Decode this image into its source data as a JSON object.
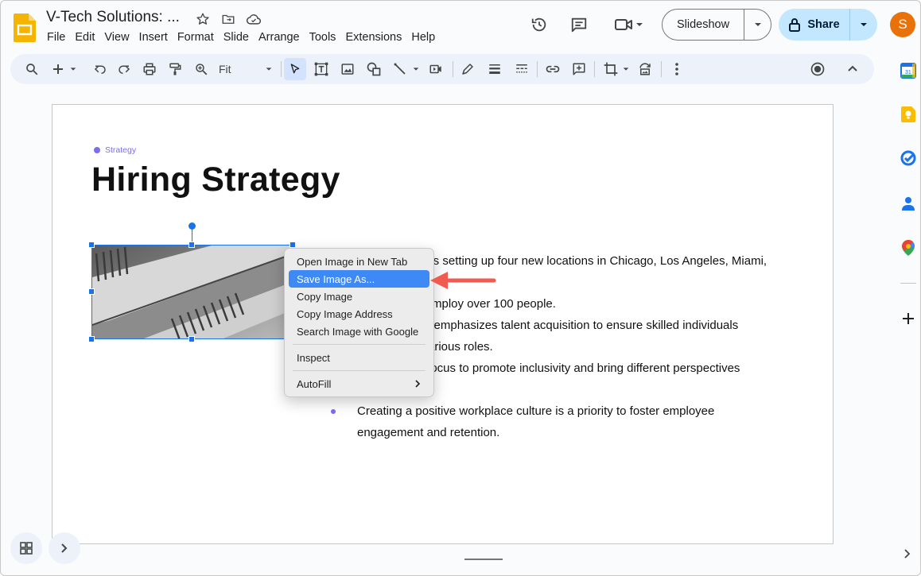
{
  "header": {
    "doc_title": "V-Tech Solutions: ...",
    "menu": [
      "File",
      "Edit",
      "View",
      "Insert",
      "Format",
      "Slide",
      "Arrange",
      "Tools",
      "Extensions",
      "Help"
    ],
    "slideshow_label": "Slideshow",
    "share_label": "Share",
    "avatar_letter": "S"
  },
  "toolbar": {
    "zoom_value": "Fit"
  },
  "slide": {
    "eyebrow": "Strategy",
    "title": "Hiring Strategy",
    "bullets": [
      "ons is setting up four new locations in Chicago, Los Angeles, Miami,",
      "vill employ over 100 people.",
      "tegy emphasizes talent acquisition to ensure skilled individuals\nor various roles.",
      "tey focus to promote inclusivity and bring different perspectives\nace.",
      "Creating a positive workplace culture is a priority to foster employee\nengagement and retention."
    ]
  },
  "context_menu": {
    "items": [
      "Open Image in New Tab",
      "Save Image As...",
      "Copy Image",
      "Copy Image Address",
      "Search Image with Google",
      "Inspect",
      "AutoFill"
    ],
    "highlighted": "Save Image As..."
  },
  "colors": {
    "accent": "#7b6cf0",
    "selection": "#1a73e8",
    "menu_highlight": "#3d8af7",
    "share_bg": "#c2e7ff",
    "annotation_arrow": "#f05a4f"
  }
}
